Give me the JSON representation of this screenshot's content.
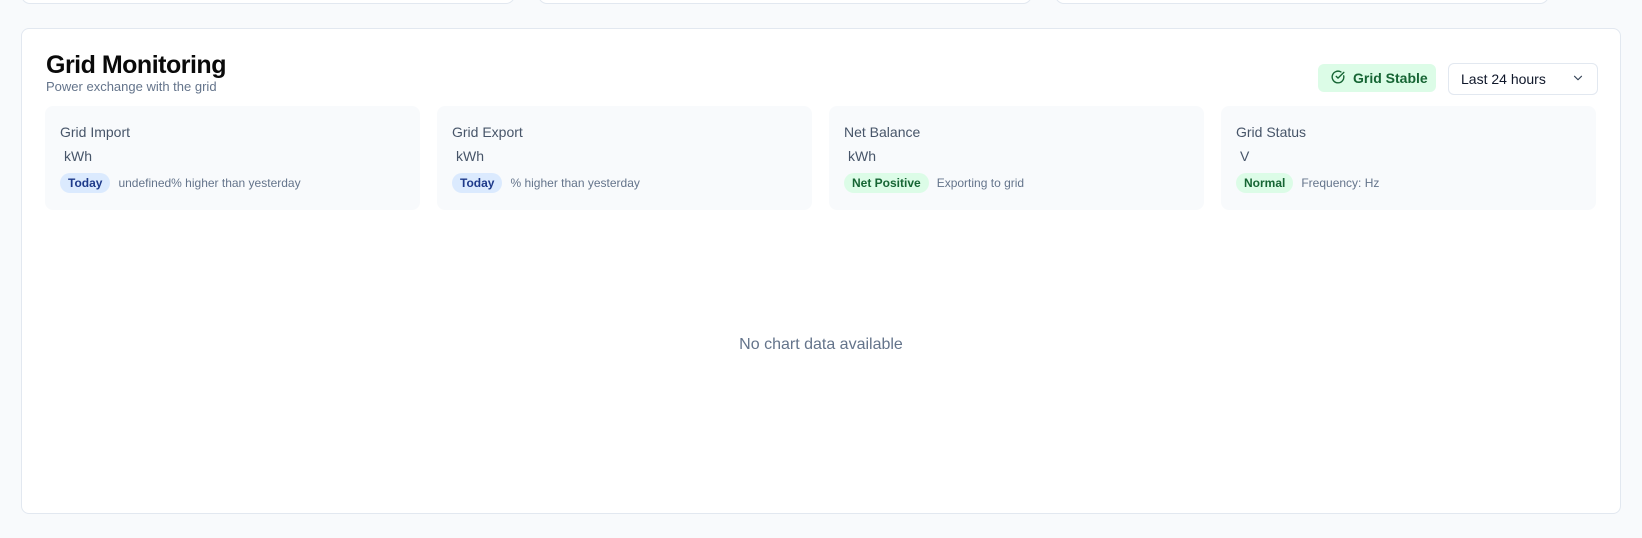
{
  "header": {
    "title": "Grid Monitoring",
    "subtitle": "Power exchange with the grid",
    "status_label": "Grid Stable",
    "range_selected": "Last 24 hours"
  },
  "metrics": [
    {
      "label": "Grid Import",
      "value": "kWh",
      "badge": "Today",
      "badge_tone": "blue",
      "note": "undefined% higher than yesterday"
    },
    {
      "label": "Grid Export",
      "value": "kWh",
      "badge": "Today",
      "badge_tone": "blue",
      "note": "% higher than yesterday"
    },
    {
      "label": "Net Balance",
      "value": "kWh",
      "badge": "Net Positive",
      "badge_tone": "green",
      "note": "Exporting to grid"
    },
    {
      "label": "Grid Status",
      "value": "V",
      "badge": "Normal",
      "badge_tone": "green",
      "note": "Frequency: Hz"
    }
  ],
  "chart": {
    "empty_message": "No chart data available"
  },
  "icons": {
    "status": "check-circle-icon",
    "dropdown": "chevron-down-icon"
  },
  "colors": {
    "success_bg": "#dcfce7",
    "success_text": "#166534",
    "info_bg": "#dbeafe",
    "info_text": "#1e3a8a"
  }
}
